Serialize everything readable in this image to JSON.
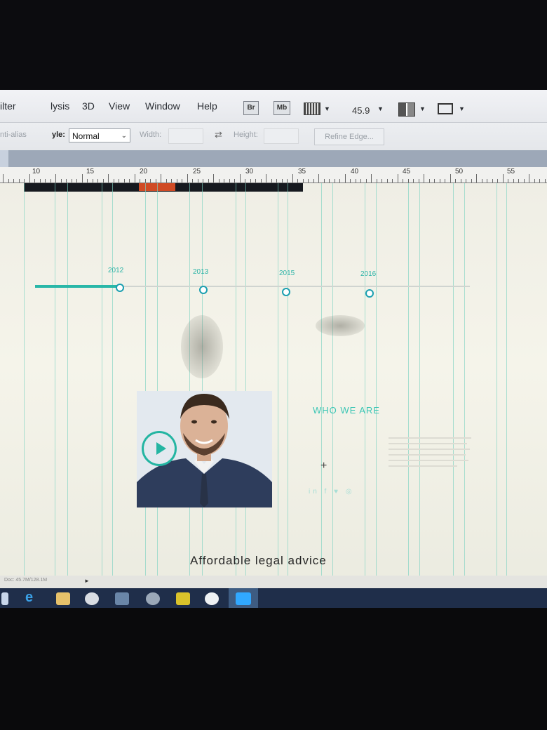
{
  "menu": {
    "items": [
      "ilter",
      "lysis",
      "3D",
      "View",
      "Window",
      "Help"
    ],
    "bridge_btn": "Br",
    "minibridge_btn": "Mb",
    "zoom": "45.9"
  },
  "options": {
    "antialias_label": "nti-alias",
    "style_label": "yle:",
    "style_value": "Normal",
    "width_label": "Width:",
    "height_label": "Height:",
    "swap_icon": "⇄",
    "refine_edge": "Refine Edge..."
  },
  "ruler": {
    "marks": [
      "10",
      "15",
      "20",
      "25",
      "30",
      "35",
      "40",
      "45",
      "50",
      "55"
    ]
  },
  "canvas": {
    "timeline_years": [
      "2012",
      "2013",
      "2015",
      "2016"
    ],
    "who_we_are": "WHO WE ARE",
    "crosshair": "+",
    "social_icons": "in f ♥ ◎",
    "tagline": "Affordable legal advice"
  },
  "status": {
    "doc_info": "Doc: 45.7M/128.1M"
  },
  "colors": {
    "accent": "#2ab3a6",
    "guide": "#7ed2c2",
    "taskbar": "#1f2e4a"
  }
}
